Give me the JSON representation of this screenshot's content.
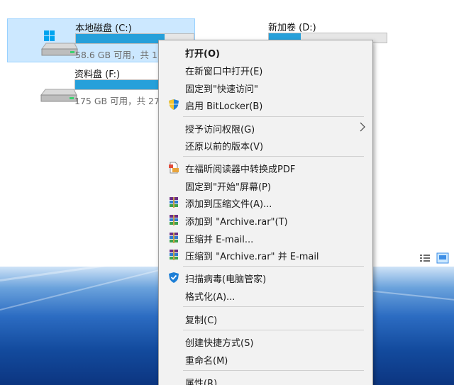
{
  "drives": [
    {
      "name": "本地磁盘 (C:)",
      "info": "58.6 GB 可用，共 1",
      "used_fraction": 0.75,
      "selected": true
    },
    {
      "name": "资料盘 (F:)",
      "info": "175 GB 可用，共 27",
      "used_fraction": 0.72,
      "selected": false
    },
    {
      "name": "新加卷 (D:)",
      "info": "",
      "used_fraction": 0.27,
      "selected": false
    }
  ],
  "colors": {
    "selection_bg": "#cce8ff",
    "bar_fill": "#26a0da",
    "menu_bg": "#f2f2f2",
    "shield_blue": "#1e7fd6"
  },
  "menu": {
    "open": "打开(O)",
    "open_new_window": "在新窗口中打开(E)",
    "pin_quick_access": "固定到\"快速访问\"",
    "bitlocker": "启用 BitLocker(B)",
    "give_access": "授予访问权限(G)",
    "restore_versions": "还原以前的版本(V)",
    "foxit_convert": "在福昕阅读器中转换成PDF",
    "pin_start": "固定到\"开始\"屏幕(P)",
    "add_archive": "添加到压缩文件(A)...",
    "add_archive_rar": "添加到 \"Archive.rar\"(T)",
    "compress_email": "压缩并 E-mail...",
    "compress_rar_email": "压缩到 \"Archive.rar\" 并 E-mail",
    "scan_virus": "扫描病毒(电脑管家)",
    "format": "格式化(A)...",
    "copy": "复制(C)",
    "create_shortcut": "创建快捷方式(S)",
    "rename": "重命名(M)",
    "properties": "属性(R)"
  }
}
